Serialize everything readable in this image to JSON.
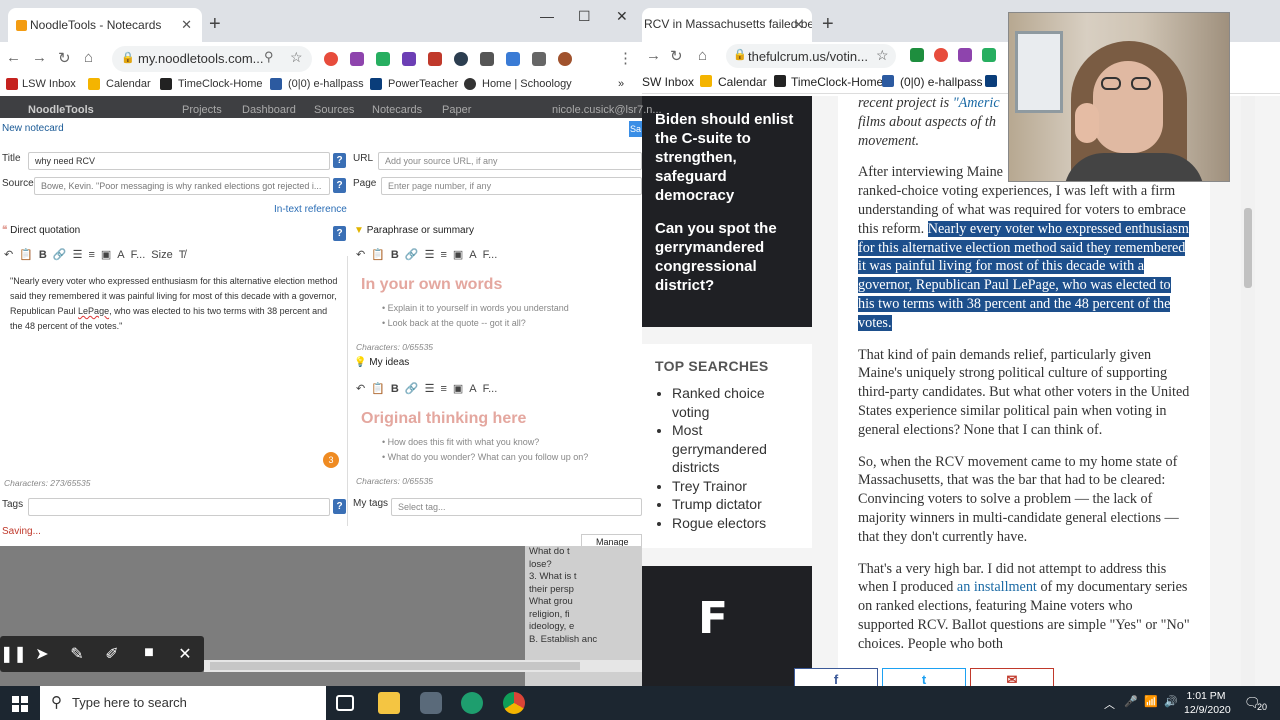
{
  "left_browser": {
    "tab_title": "NoodleTools - Notecards",
    "url": "my.noodletools.com...",
    "bookmarks": [
      "LSW Inbox",
      "Calendar",
      "TimeClock-Home",
      "(0|0) e-hallpass",
      "PowerTeacher",
      "Home | Schoology"
    ],
    "bookmarks_more": "»"
  },
  "noodletools": {
    "brand": "NoodleTools",
    "nav": [
      "Projects",
      "Dashboard",
      "Sources",
      "Notecards",
      "Paper"
    ],
    "user": "nicole.cusick@lsr7.n...",
    "header": "New notecard",
    "save_tab": "Sa",
    "title_label": "Title",
    "title_value": "why need RCV",
    "url_label": "URL",
    "url_placeholder": "Add your source URL, if any",
    "source_label": "Source",
    "source_value": "Bowe, Kevin. \"Poor messaging is why ranked elections got rejected i...",
    "page_label": "Page",
    "page_placeholder": "Enter page number, if any",
    "intext_ref": "In-text reference",
    "direct_quote_label": "Direct quotation",
    "paraphrase_label": "Paraphrase or summary",
    "quote_text_a": "\"Nearly every voter who expressed enthusiasm for this alternative election method said they remembered it was painful living for most of this decade with a governor, Republican Paul ",
    "quote_text_name": "LePage",
    "quote_text_b": ", who was elected to his two terms with 38 percent and the 48 percent of the votes.\"",
    "quote_count": "Characters: 273/65535",
    "badge": "3",
    "paraphrase_big": "In your own words",
    "paraphrase_hints": [
      "Explain it to yourself in words you understand",
      "Look back at the quote -- got it all?"
    ],
    "paraphrase_count": "Characters: 0/65535",
    "ideas_label": "My ideas",
    "ideas_big": "Original thinking here",
    "ideas_hints": [
      "How does this fit with what you know?",
      "What do you wonder? What can you follow up on?"
    ],
    "ideas_count": "Characters: 0/65535",
    "tags_label": "Tags",
    "mytags_label": "My tags",
    "mytags_placeholder": "Select tag...",
    "saving": "Saving...",
    "toolbar_font": "F...",
    "toolbar_size": "Size",
    "manage": "Manage ver"
  },
  "lower_page": {
    "lines": [
      "What do t",
      "lose?",
      "3.  What is t",
      "their persp",
      "What grou",
      "religion, fi",
      "ideology, e",
      "B.  Establish anc"
    ]
  },
  "right_browser": {
    "tab_title": "RCV in Massachusetts failed beca",
    "url": "thefulcrum.us/votin...",
    "bookmarks": [
      "SW Inbox",
      "Calendar",
      "TimeClock-Home",
      "(0|0) e-hallpass"
    ]
  },
  "fulcrum": {
    "promo_1": "Biden should enlist the C-suite to strengthen, safeguard democracy",
    "promo_2": "Can you spot the gerrymandered congressional district?",
    "top_searches_title": "TOP SEARCHES",
    "top_searches": [
      "Ranked choice voting",
      "Most gerrymandered districts",
      "Trey Trainor",
      "Trump dictator",
      "Rogue electors"
    ],
    "logo": "F",
    "intro_a": "recent project is ",
    "intro_link": "\"Americ",
    "intro_b": "films about aspects of th",
    "intro_c": "movement.",
    "para1_a": "After interviewing Maine",
    "para1_b": "ranked-choice voting experiences, I was left with a firm understanding of what was required for voters to embrace this reform.",
    "para1_highlight": "Nearly every voter who expressed enthusiasm for this alternative election method said they remembered it was painful living for most of this decade with a governor, Republican Paul LePage, who was elected to his two terms with 38 percent and the 48 percent of the votes.",
    "para2": "That kind of pain demands relief, particularly given Maine's uniquely strong political culture of supporting third-party candidates. But what other voters in the United States experience similar political pain when voting in general elections? None that I can think of.",
    "para3": "So, when the RCV movement came to my home state of Massachusetts, that was the bar that had to be cleared: Convincing voters to solve a problem — the lack of majority winners in multi-candidate general elections — that they don't currently have.",
    "para4_a": "That's a very high bar. I did not attempt to address this when I produced ",
    "para4_link": "an installment",
    "para4_b": " of my documentary series on ranked elections, featuring Maine voters who supported RCV. Ballot questions are simple \"Yes\" or \"No\" choices. People who both",
    "share": [
      "f",
      "t",
      "✉"
    ]
  },
  "taskbar": {
    "search_placeholder": "Type here to search",
    "time": "1:01 PM",
    "date": "12/9/2020",
    "notifications": "20"
  },
  "colors": {
    "highlight": "#1d4f8c",
    "link": "#1b6aa5",
    "promo_bg": "#1f2024",
    "placeholder_big": "#e4a79f",
    "help_blue": "#3a6fb5",
    "badge_orange": "#ef8b22",
    "facebook": "#3b5998",
    "twitter": "#1da1f2",
    "email": "#c0392b"
  }
}
